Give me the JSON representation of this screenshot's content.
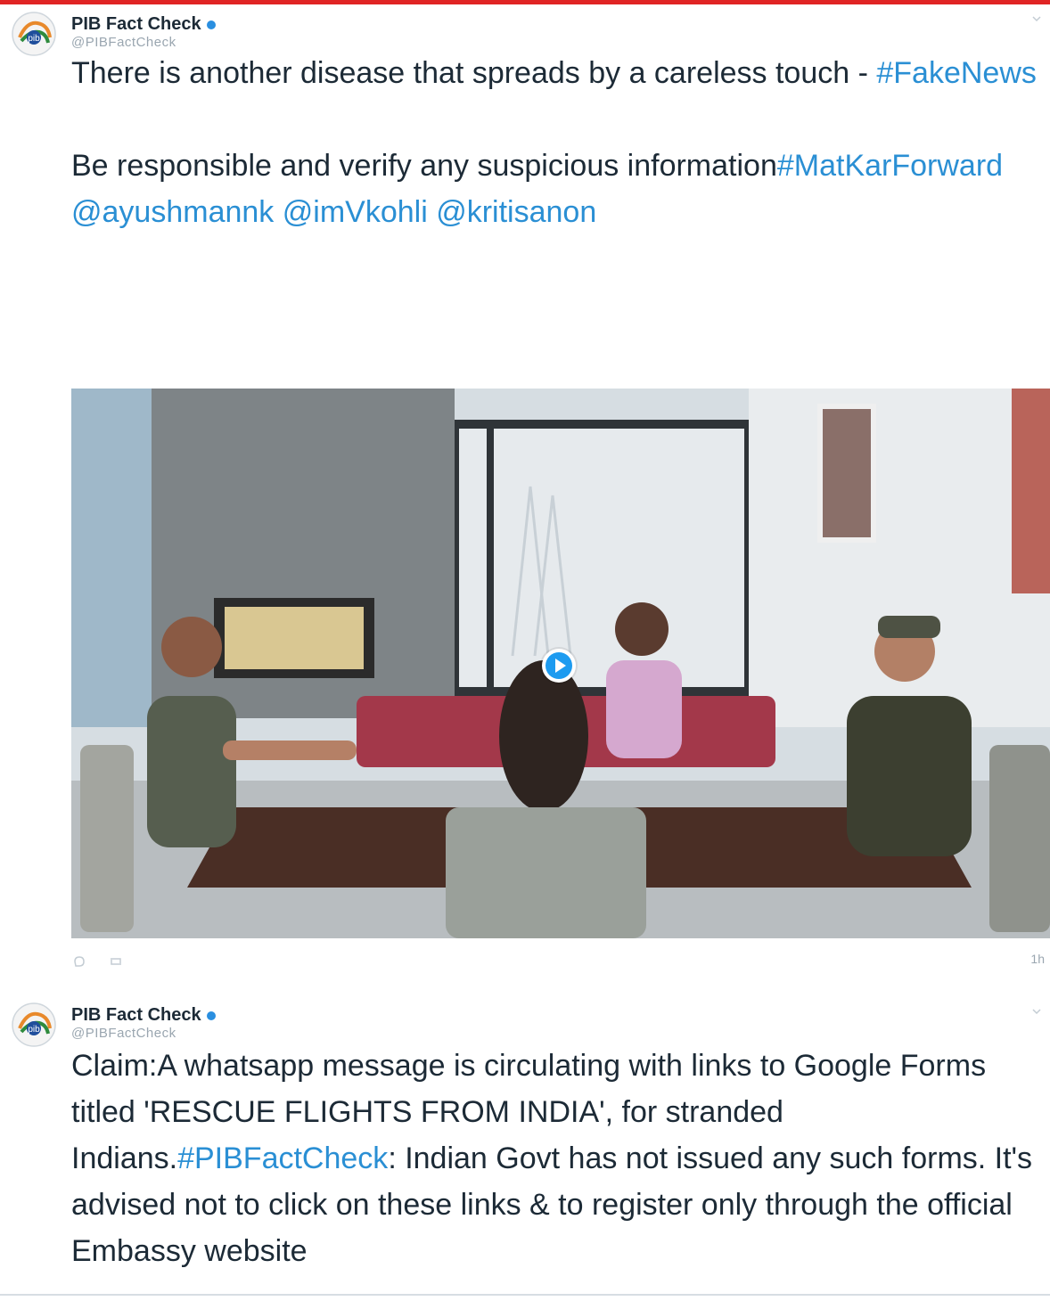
{
  "tweets": [
    {
      "author_name": "PIB Fact Check",
      "author_handle": "@PIBFactCheck",
      "avatar_icon": "pib-logo-icon",
      "text_parts": [
        {
          "t": "There is another disease that spreads by a careless touch - "
        },
        {
          "t": "#FakeNews",
          "kind": "tag"
        }
      ],
      "text_parts_2": [
        {
          "t": "Be responsible and verify any suspicious information"
        },
        {
          "t": "#MatKarForward",
          "kind": "tag"
        },
        {
          "t": " "
        },
        {
          "t": "@ayushmannk",
          "kind": "mention"
        },
        {
          "t": " "
        },
        {
          "t": "@imVkohli",
          "kind": "mention"
        },
        {
          "t": " "
        },
        {
          "t": "@kritisanon",
          "kind": "mention"
        }
      ],
      "media": {
        "type": "video",
        "play_icon": "play-icon"
      },
      "timestamp": "1h"
    },
    {
      "author_name": "PIB Fact Check",
      "author_handle": "@PIBFactCheck",
      "avatar_icon": "pib-logo-icon",
      "text_parts": [
        {
          "t": "Claim:A whatsapp message is circulating with links to Google Forms titled 'RESCUE FLIGHTS FROM INDIA', for stranded Indians."
        },
        {
          "t": "#PIBFactCheck",
          "kind": "tag"
        },
        {
          "t": ": Indian Govt has not issued any such forms. It's advised not to click on these links & to register only through the official Embassy website"
        }
      ]
    }
  ],
  "colors": {
    "link": "#2a8fd4",
    "accent_bar": "#e02424",
    "verified": "#2a8fe0"
  }
}
